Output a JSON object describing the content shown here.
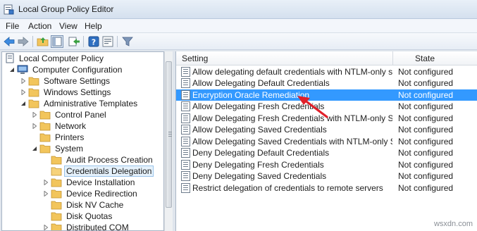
{
  "window": {
    "title": "Local Group Policy Editor",
    "icon": "policy-editor-icon"
  },
  "menu": [
    "File",
    "Action",
    "View",
    "Help"
  ],
  "toolbar": {
    "buttons": [
      "back-arrow-icon",
      "forward-arrow-icon",
      "up-folder-icon",
      "show-hide-tree-icon",
      "export-list-icon",
      "help-icon",
      "properties-icon",
      "filter-icon"
    ]
  },
  "tree": {
    "items": [
      {
        "label": "Local Computer Policy",
        "icon": "computer-policy-icon",
        "expander": "none",
        "selected": false
      },
      {
        "label": "Computer Configuration",
        "icon": "computer-icon",
        "expander": "expanded",
        "selected": false
      },
      {
        "label": "Software Settings",
        "icon": "folder-icon",
        "expander": "collapsed",
        "selected": false
      },
      {
        "label": "Windows Settings",
        "icon": "folder-icon",
        "expander": "collapsed",
        "selected": false
      },
      {
        "label": "Administrative Templates",
        "icon": "folder-icon",
        "expander": "expanded",
        "selected": false
      },
      {
        "label": "Control Panel",
        "icon": "folder-icon",
        "expander": "collapsed",
        "selected": false
      },
      {
        "label": "Network",
        "icon": "folder-icon",
        "expander": "collapsed",
        "selected": false
      },
      {
        "label": "Printers",
        "icon": "folder-icon",
        "expander": "none",
        "selected": false
      },
      {
        "label": "System",
        "icon": "folder-icon",
        "expander": "expanded",
        "selected": false
      },
      {
        "label": "Audit Process Creation",
        "icon": "folder-icon",
        "expander": "none",
        "selected": false
      },
      {
        "label": "Credentials Delegation",
        "icon": "folder-icon",
        "expander": "none",
        "selected": true
      },
      {
        "label": "Device Installation",
        "icon": "folder-icon",
        "expander": "collapsed",
        "selected": false
      },
      {
        "label": "Device Redirection",
        "icon": "folder-icon",
        "expander": "collapsed",
        "selected": false
      },
      {
        "label": "Disk NV Cache",
        "icon": "folder-icon",
        "expander": "none",
        "selected": false
      },
      {
        "label": "Disk Quotas",
        "icon": "folder-icon",
        "expander": "none",
        "selected": false
      },
      {
        "label": "Distributed COM",
        "icon": "folder-icon",
        "expander": "collapsed",
        "selected": false
      }
    ]
  },
  "list": {
    "columns": [
      "Setting",
      "State"
    ],
    "rows": [
      {
        "setting": "Allow delegating default credentials with NTLM-only server ...",
        "state": "Not configured",
        "selected": false
      },
      {
        "setting": "Allow Delegating Default Credentials",
        "state": "Not configured",
        "selected": false
      },
      {
        "setting": "Encryption Oracle Remediation",
        "state": "Not configured",
        "selected": true
      },
      {
        "setting": "Allow Delegating Fresh Credentials",
        "state": "Not configured",
        "selected": false
      },
      {
        "setting": "Allow Delegating Fresh Credentials with NTLM-only Server ...",
        "state": "Not configured",
        "selected": false
      },
      {
        "setting": "Allow Delegating Saved Credentials",
        "state": "Not configured",
        "selected": false
      },
      {
        "setting": "Allow Delegating Saved Credentials with NTLM-only Server ...",
        "state": "Not configured",
        "selected": false
      },
      {
        "setting": "Deny Delegating Default Credentials",
        "state": "Not configured",
        "selected": false
      },
      {
        "setting": "Deny Delegating Fresh Credentials",
        "state": "Not configured",
        "selected": false
      },
      {
        "setting": "Deny Delegating Saved Credentials",
        "state": "Not configured",
        "selected": false
      },
      {
        "setting": "Restrict delegation of credentials to remote servers",
        "state": "Not configured",
        "selected": false
      }
    ]
  },
  "annotation": {
    "arrow_color": "#e0202a",
    "icon": "red-arrow-icon"
  },
  "colors": {
    "selection": "#3399ff",
    "tree_selection": "#e5f1fb",
    "folder": "#f2c55c"
  },
  "watermark": "wsxdn.com"
}
